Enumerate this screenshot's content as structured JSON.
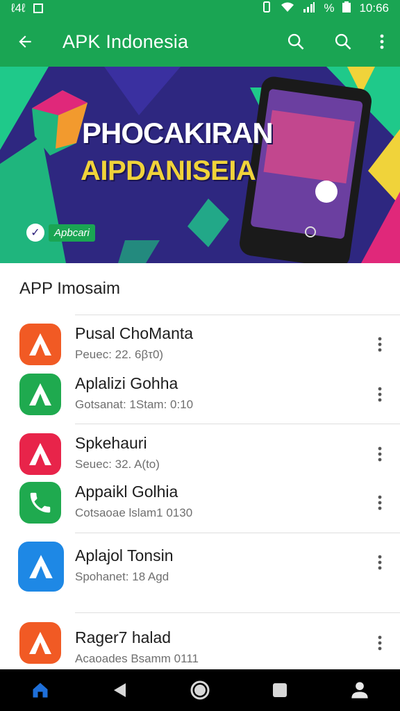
{
  "status_bar": {
    "left_text": "ℓ4ℓ",
    "signal_text": "%",
    "time": "10:66"
  },
  "app_bar": {
    "title": "APK Indonesia",
    "icons": [
      "back-arrow-icon",
      "search-icon",
      "search-icon",
      "more-vert-icon"
    ],
    "background_color": "#1aa553"
  },
  "banner": {
    "headline": "PHOCAKIRAN",
    "subheadline": "AIPDANISEIA",
    "badge_text": "Apbcari",
    "colors": {
      "background": "#2e2780",
      "accent_green": "#1fc98a",
      "accent_yellow": "#f0d33a",
      "accent_pink": "#e0287a"
    }
  },
  "section": {
    "title": "APP Imosaim"
  },
  "apps": [
    {
      "name": "Pusal ChoManta",
      "meta": "Peuec: 22. 6βτ0)",
      "icon_color": "#f15a24",
      "icon": "app-a-icon"
    },
    {
      "name": "Aplalizi Gohha",
      "meta": "Gotsanat: 1Stam: 0:10",
      "icon_color": "#1faa4f",
      "icon": "app-a-icon"
    },
    {
      "name": "Spkehauri",
      "meta": "Seuec: 32. A(to)",
      "icon_color": "#e8244a",
      "icon": "app-a-icon"
    },
    {
      "name": "Appaikl Golhia",
      "meta": "Cotsaoae lslam1 0130",
      "icon_color": "#1faa4f",
      "icon": "phone-icon"
    },
    {
      "name": "Aplajol Tonsin",
      "meta": "Spohanet: 18 Agd",
      "icon_color": "#1e88e5",
      "icon": "app-a-icon"
    },
    {
      "name": "Rager7 halad",
      "meta": "Acaoades Bsamm 0111",
      "icon_color": "#f15a24",
      "icon": "app-a-icon"
    }
  ],
  "nav_bar": {
    "icons": [
      "home-icon",
      "back-triangle-icon",
      "home-circle-icon",
      "recents-square-icon",
      "account-icon"
    ]
  }
}
